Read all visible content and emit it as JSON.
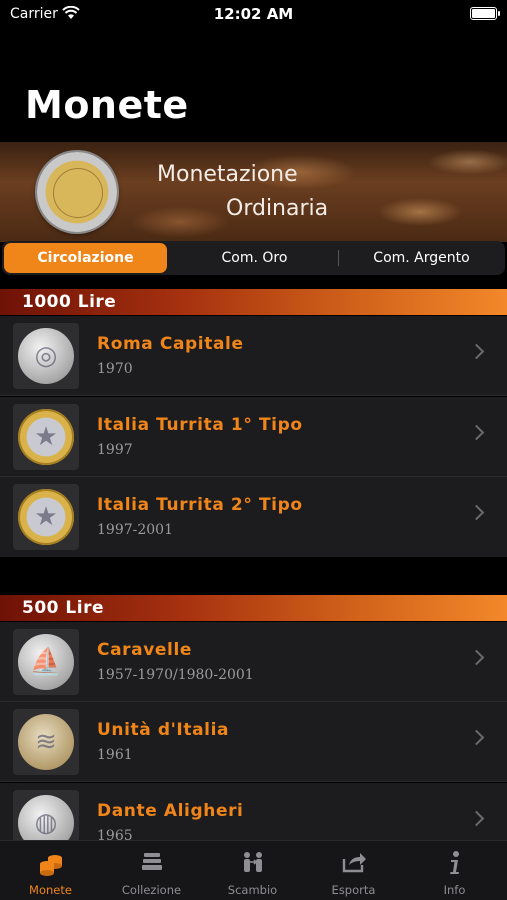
{
  "status": {
    "carrier": "Carrier",
    "time": "12:02 AM"
  },
  "title": "Monete",
  "hero": {
    "line1": "Monetazione",
    "line2": "Ordinaria",
    "coin_icon": "coin-icon"
  },
  "segments": [
    {
      "label": "Circolazione",
      "selected": true
    },
    {
      "label": "Com. Oro",
      "selected": false
    },
    {
      "label": "Com. Argento",
      "selected": false
    }
  ],
  "sections": [
    {
      "header": "1000 Lire",
      "items": [
        {
          "title": "Roma Capitale",
          "subtitle": "1970"
        },
        {
          "title": "Italia Turrita 1° Tipo",
          "subtitle": "1997"
        },
        {
          "title": "Italia Turrita 2° Tipo",
          "subtitle": "1997-2001"
        }
      ]
    },
    {
      "header": "500 Lire",
      "items": [
        {
          "title": "Caravelle",
          "subtitle": "1957-1970/1980-2001"
        },
        {
          "title": "Unità d'Italia",
          "subtitle": "1961"
        },
        {
          "title": "Dante Aligheri",
          "subtitle": "1965"
        }
      ]
    }
  ],
  "tabs": [
    {
      "label": "Monete",
      "icon": "coins-icon",
      "active": true
    },
    {
      "label": "Collezione",
      "icon": "stack-icon",
      "active": false
    },
    {
      "label": "Scambio",
      "icon": "exchange-icon",
      "active": false
    },
    {
      "label": "Esporta",
      "icon": "share-icon",
      "active": false
    },
    {
      "label": "Info",
      "icon": "info-icon",
      "active": false
    }
  ],
  "colors": {
    "accent": "#f08519",
    "background": "#000000",
    "row": "#1c1c1e"
  }
}
